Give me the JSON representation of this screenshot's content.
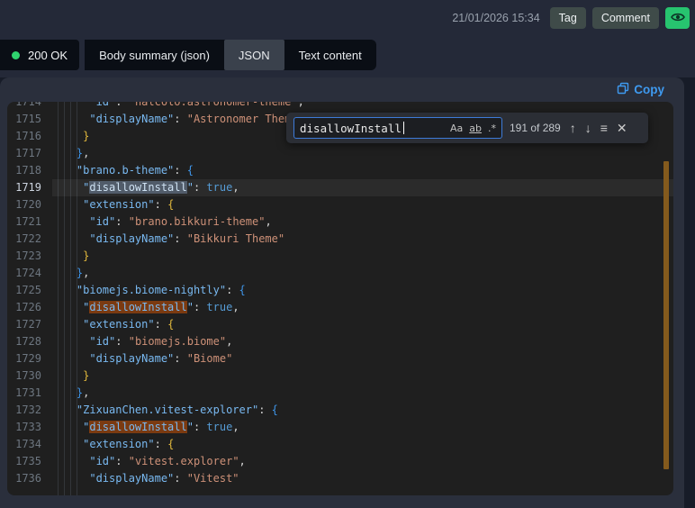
{
  "header": {
    "timestamp": "21/01/2026 15:34",
    "tag_label": "Tag",
    "comment_label": "Comment",
    "eye_button_color": "#27c46f"
  },
  "tabs": {
    "status": {
      "label": "200 OK",
      "dot_color": "#2fd36e"
    },
    "items": [
      {
        "label": "Body summary (json)",
        "active": false
      },
      {
        "label": "JSON",
        "active": true
      },
      {
        "label": "Text content",
        "active": false
      }
    ]
  },
  "panel": {
    "copy_label": "Copy",
    "accent_color": "#3e9af0"
  },
  "find": {
    "query": "disallowInstall",
    "match_case_label": "Aa",
    "whole_word_label": "ab",
    "regex_label": ".*",
    "results_count": "191 of 289",
    "prev_icon": "↑",
    "next_icon": "↓",
    "selection_icon": "≡",
    "close_icon": "✕"
  },
  "editor": {
    "match_color": "#EA5C00",
    "current_match_color": "#515C6A",
    "lines": [
      {
        "num": "1714",
        "indent": 6,
        "tokens": [
          {
            "c": "k",
            "v": "\"id\""
          },
          {
            "c": "p",
            "v": ": "
          },
          {
            "c": "s",
            "v": "\"halcolo.astronomer-theme\""
          },
          {
            "c": "p",
            "v": ","
          }
        ]
      },
      {
        "num": "1715",
        "indent": 6,
        "tokens": [
          {
            "c": "k",
            "v": "\"displayName\""
          },
          {
            "c": "p",
            "v": ": "
          },
          {
            "c": "s",
            "v": "\"Astronomer Theme\""
          }
        ]
      },
      {
        "num": "1716",
        "indent": 5,
        "tokens": [
          {
            "c": "bg",
            "v": "}"
          }
        ]
      },
      {
        "num": "1717",
        "indent": 4,
        "tokens": [
          {
            "c": "bb",
            "v": "}"
          },
          {
            "c": "p",
            "v": ","
          }
        ]
      },
      {
        "num": "1718",
        "indent": 4,
        "tokens": [
          {
            "c": "k",
            "v": "\"brano.b-theme\""
          },
          {
            "c": "p",
            "v": ": "
          },
          {
            "c": "bb",
            "v": "{"
          }
        ]
      },
      {
        "num": "1719",
        "indent": 5,
        "current": true,
        "tokens": [
          {
            "c": "k",
            "v": "\""
          },
          {
            "c": "mc",
            "v": "disallowInstall"
          },
          {
            "c": "k",
            "v": "\""
          },
          {
            "c": "p",
            "v": ": "
          },
          {
            "c": "b",
            "v": "true"
          },
          {
            "c": "p",
            "v": ","
          }
        ]
      },
      {
        "num": "1720",
        "indent": 5,
        "tokens": [
          {
            "c": "k",
            "v": "\"extension\""
          },
          {
            "c": "p",
            "v": ": "
          },
          {
            "c": "bg",
            "v": "{"
          }
        ]
      },
      {
        "num": "1721",
        "indent": 6,
        "tokens": [
          {
            "c": "k",
            "v": "\"id\""
          },
          {
            "c": "p",
            "v": ": "
          },
          {
            "c": "s",
            "v": "\"brano.bikkuri-theme\""
          },
          {
            "c": "p",
            "v": ","
          }
        ]
      },
      {
        "num": "1722",
        "indent": 6,
        "tokens": [
          {
            "c": "k",
            "v": "\"displayName\""
          },
          {
            "c": "p",
            "v": ": "
          },
          {
            "c": "s",
            "v": "\"Bikkuri Theme\""
          }
        ]
      },
      {
        "num": "1723",
        "indent": 5,
        "tokens": [
          {
            "c": "bg",
            "v": "}"
          }
        ]
      },
      {
        "num": "1724",
        "indent": 4,
        "tokens": [
          {
            "c": "bb",
            "v": "}"
          },
          {
            "c": "p",
            "v": ","
          }
        ]
      },
      {
        "num": "1725",
        "indent": 4,
        "tokens": [
          {
            "c": "k",
            "v": "\"biomejs.biome-nightly\""
          },
          {
            "c": "p",
            "v": ": "
          },
          {
            "c": "bb",
            "v": "{"
          }
        ]
      },
      {
        "num": "1726",
        "indent": 5,
        "tokens": [
          {
            "c": "k",
            "v": "\""
          },
          {
            "c": "m",
            "v": "disallowInstall"
          },
          {
            "c": "k",
            "v": "\""
          },
          {
            "c": "p",
            "v": ": "
          },
          {
            "c": "b",
            "v": "true"
          },
          {
            "c": "p",
            "v": ","
          }
        ]
      },
      {
        "num": "1727",
        "indent": 5,
        "tokens": [
          {
            "c": "k",
            "v": "\"extension\""
          },
          {
            "c": "p",
            "v": ": "
          },
          {
            "c": "bg",
            "v": "{"
          }
        ]
      },
      {
        "num": "1728",
        "indent": 6,
        "tokens": [
          {
            "c": "k",
            "v": "\"id\""
          },
          {
            "c": "p",
            "v": ": "
          },
          {
            "c": "s",
            "v": "\"biomejs.biome\""
          },
          {
            "c": "p",
            "v": ","
          }
        ]
      },
      {
        "num": "1729",
        "indent": 6,
        "tokens": [
          {
            "c": "k",
            "v": "\"displayName\""
          },
          {
            "c": "p",
            "v": ": "
          },
          {
            "c": "s",
            "v": "\"Biome\""
          }
        ]
      },
      {
        "num": "1730",
        "indent": 5,
        "tokens": [
          {
            "c": "bg",
            "v": "}"
          }
        ]
      },
      {
        "num": "1731",
        "indent": 4,
        "tokens": [
          {
            "c": "bb",
            "v": "}"
          },
          {
            "c": "p",
            "v": ","
          }
        ]
      },
      {
        "num": "1732",
        "indent": 4,
        "tokens": [
          {
            "c": "k",
            "v": "\"ZixuanChen.vitest-explorer\""
          },
          {
            "c": "p",
            "v": ": "
          },
          {
            "c": "bb",
            "v": "{"
          }
        ]
      },
      {
        "num": "1733",
        "indent": 5,
        "tokens": [
          {
            "c": "k",
            "v": "\""
          },
          {
            "c": "m",
            "v": "disallowInstall"
          },
          {
            "c": "k",
            "v": "\""
          },
          {
            "c": "p",
            "v": ": "
          },
          {
            "c": "b",
            "v": "true"
          },
          {
            "c": "p",
            "v": ","
          }
        ]
      },
      {
        "num": "1734",
        "indent": 5,
        "tokens": [
          {
            "c": "k",
            "v": "\"extension\""
          },
          {
            "c": "p",
            "v": ": "
          },
          {
            "c": "bg",
            "v": "{"
          }
        ]
      },
      {
        "num": "1735",
        "indent": 6,
        "tokens": [
          {
            "c": "k",
            "v": "\"id\""
          },
          {
            "c": "p",
            "v": ": "
          },
          {
            "c": "s",
            "v": "\"vitest.explorer\""
          },
          {
            "c": "p",
            "v": ","
          }
        ]
      },
      {
        "num": "1736",
        "indent": 6,
        "tokens": [
          {
            "c": "k",
            "v": "\"displayName\""
          },
          {
            "c": "p",
            "v": ": "
          },
          {
            "c": "s",
            "v": "\"Vitest\""
          }
        ]
      }
    ]
  }
}
